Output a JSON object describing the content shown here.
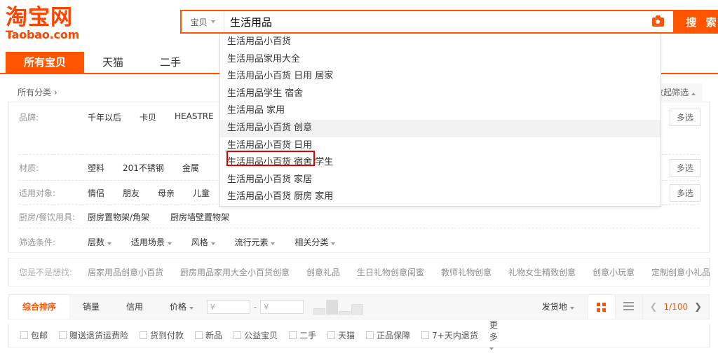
{
  "brand": {
    "logo_main": "淘宝网",
    "logo_sub": "Taobao.com"
  },
  "search": {
    "category_label": "宝贝",
    "query_value": "生活用品",
    "placeholder": "",
    "camera_icon": "camera-icon",
    "button_label": "搜 索"
  },
  "suggestions": [
    "生活用品小百货",
    "生活用品家用大全",
    "生活用品小百货 日用 居家",
    "生活用品学生 宿舍",
    "生活用品 家用",
    "生活用品小百货 创意",
    "生活用品小百货 日用",
    "生活用品小百货 宿舍 学生",
    "生活用品小百货 家居",
    "生活用品小百货 厨房 家用"
  ],
  "suggestion_highlight_index": 5,
  "nav": {
    "tabs": [
      {
        "label": "所有宝贝",
        "active": true
      },
      {
        "label": "天猫",
        "active": false
      },
      {
        "label": "二手",
        "active": false
      }
    ]
  },
  "filters": {
    "all_categories": "所有分类 ›",
    "collapse_label": "收起筛选",
    "multi_label": "多选",
    "rows": [
      {
        "label": "品牌:",
        "values": [
          "千年以后",
          "卡贝",
          "HEASTRE"
        ],
        "multi": true
      },
      {
        "label": "材质:",
        "values": [
          "塑料",
          "201不锈钢",
          "金属"
        ],
        "multi": true
      },
      {
        "label": "适用对象:",
        "values": [
          "情侣",
          "朋友",
          "母亲",
          "儿童"
        ],
        "multi": true
      },
      {
        "label": "厨房/餐饮用具:",
        "values": [
          "厨房置物架/角架",
          "厨房墙壁置物架"
        ],
        "multi": false
      }
    ],
    "condition_label": "筛选条件:",
    "conditions": [
      "层数",
      "适用场景",
      "风格",
      "流行元素",
      "相关分类"
    ]
  },
  "did_you_mean": {
    "label": "您是不是想找:",
    "links": [
      "居家用品创意小百货",
      "厨房用品家用大全小百货创意",
      "创意礼品",
      "生日礼物创意闺蜜",
      "教师礼物创意",
      "礼物女生精致创意",
      "创意小玩意",
      "定制创意小礼品"
    ]
  },
  "sortbar": {
    "items": [
      {
        "label": "综合排序",
        "active": true,
        "caret": false
      },
      {
        "label": "销量",
        "active": false,
        "caret": false
      },
      {
        "label": "信用",
        "active": false,
        "caret": false
      },
      {
        "label": "价格",
        "active": false,
        "caret": true
      }
    ],
    "currency": "¥",
    "price_min": "",
    "price_max": "",
    "range_separator": "-",
    "ship_from_label": "发货地",
    "view_grid_icon": "grid-view-icon",
    "view_list_icon": "list-view-icon",
    "prev_icon": "chevron-left-icon",
    "next_icon": "chevron-right-icon",
    "page_indicator": "1/100"
  },
  "checkboxes": {
    "items": [
      "包邮",
      "赠送退货运费险",
      "货到付款",
      "新品",
      "公益宝贝",
      "二手",
      "天猫",
      "正品保障",
      "7+天内退货"
    ],
    "more_label": "更多"
  },
  "colors": {
    "brand_orange": "#ff5500",
    "logo_orange": "#ff4400",
    "highlight_red": "#e40000",
    "panel_border": "#eeeeee"
  }
}
